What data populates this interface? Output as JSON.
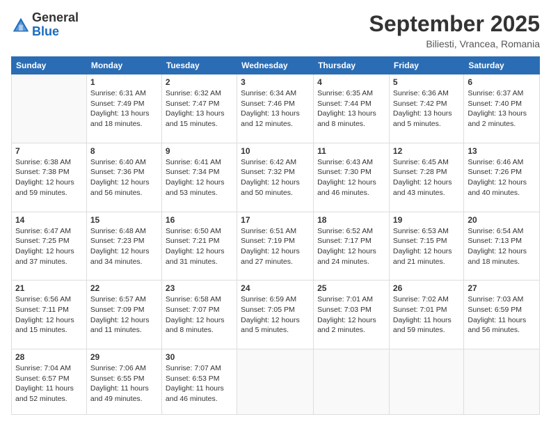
{
  "logo": {
    "general": "General",
    "blue": "Blue"
  },
  "header": {
    "month": "September 2025",
    "location": "Biliesti, Vrancea, Romania"
  },
  "days_of_week": [
    "Sunday",
    "Monday",
    "Tuesday",
    "Wednesday",
    "Thursday",
    "Friday",
    "Saturday"
  ],
  "weeks": [
    [
      {
        "num": "",
        "sunrise": "",
        "sunset": "",
        "daylight": "",
        "empty": true
      },
      {
        "num": "1",
        "sunrise": "Sunrise: 6:31 AM",
        "sunset": "Sunset: 7:49 PM",
        "daylight": "Daylight: 13 hours and 18 minutes."
      },
      {
        "num": "2",
        "sunrise": "Sunrise: 6:32 AM",
        "sunset": "Sunset: 7:47 PM",
        "daylight": "Daylight: 13 hours and 15 minutes."
      },
      {
        "num": "3",
        "sunrise": "Sunrise: 6:34 AM",
        "sunset": "Sunset: 7:46 PM",
        "daylight": "Daylight: 13 hours and 12 minutes."
      },
      {
        "num": "4",
        "sunrise": "Sunrise: 6:35 AM",
        "sunset": "Sunset: 7:44 PM",
        "daylight": "Daylight: 13 hours and 8 minutes."
      },
      {
        "num": "5",
        "sunrise": "Sunrise: 6:36 AM",
        "sunset": "Sunset: 7:42 PM",
        "daylight": "Daylight: 13 hours and 5 minutes."
      },
      {
        "num": "6",
        "sunrise": "Sunrise: 6:37 AM",
        "sunset": "Sunset: 7:40 PM",
        "daylight": "Daylight: 13 hours and 2 minutes."
      }
    ],
    [
      {
        "num": "7",
        "sunrise": "Sunrise: 6:38 AM",
        "sunset": "Sunset: 7:38 PM",
        "daylight": "Daylight: 12 hours and 59 minutes."
      },
      {
        "num": "8",
        "sunrise": "Sunrise: 6:40 AM",
        "sunset": "Sunset: 7:36 PM",
        "daylight": "Daylight: 12 hours and 56 minutes."
      },
      {
        "num": "9",
        "sunrise": "Sunrise: 6:41 AM",
        "sunset": "Sunset: 7:34 PM",
        "daylight": "Daylight: 12 hours and 53 minutes."
      },
      {
        "num": "10",
        "sunrise": "Sunrise: 6:42 AM",
        "sunset": "Sunset: 7:32 PM",
        "daylight": "Daylight: 12 hours and 50 minutes."
      },
      {
        "num": "11",
        "sunrise": "Sunrise: 6:43 AM",
        "sunset": "Sunset: 7:30 PM",
        "daylight": "Daylight: 12 hours and 46 minutes."
      },
      {
        "num": "12",
        "sunrise": "Sunrise: 6:45 AM",
        "sunset": "Sunset: 7:28 PM",
        "daylight": "Daylight: 12 hours and 43 minutes."
      },
      {
        "num": "13",
        "sunrise": "Sunrise: 6:46 AM",
        "sunset": "Sunset: 7:26 PM",
        "daylight": "Daylight: 12 hours and 40 minutes."
      }
    ],
    [
      {
        "num": "14",
        "sunrise": "Sunrise: 6:47 AM",
        "sunset": "Sunset: 7:25 PM",
        "daylight": "Daylight: 12 hours and 37 minutes."
      },
      {
        "num": "15",
        "sunrise": "Sunrise: 6:48 AM",
        "sunset": "Sunset: 7:23 PM",
        "daylight": "Daylight: 12 hours and 34 minutes."
      },
      {
        "num": "16",
        "sunrise": "Sunrise: 6:50 AM",
        "sunset": "Sunset: 7:21 PM",
        "daylight": "Daylight: 12 hours and 31 minutes."
      },
      {
        "num": "17",
        "sunrise": "Sunrise: 6:51 AM",
        "sunset": "Sunset: 7:19 PM",
        "daylight": "Daylight: 12 hours and 27 minutes."
      },
      {
        "num": "18",
        "sunrise": "Sunrise: 6:52 AM",
        "sunset": "Sunset: 7:17 PM",
        "daylight": "Daylight: 12 hours and 24 minutes."
      },
      {
        "num": "19",
        "sunrise": "Sunrise: 6:53 AM",
        "sunset": "Sunset: 7:15 PM",
        "daylight": "Daylight: 12 hours and 21 minutes."
      },
      {
        "num": "20",
        "sunrise": "Sunrise: 6:54 AM",
        "sunset": "Sunset: 7:13 PM",
        "daylight": "Daylight: 12 hours and 18 minutes."
      }
    ],
    [
      {
        "num": "21",
        "sunrise": "Sunrise: 6:56 AM",
        "sunset": "Sunset: 7:11 PM",
        "daylight": "Daylight: 12 hours and 15 minutes."
      },
      {
        "num": "22",
        "sunrise": "Sunrise: 6:57 AM",
        "sunset": "Sunset: 7:09 PM",
        "daylight": "Daylight: 12 hours and 11 minutes."
      },
      {
        "num": "23",
        "sunrise": "Sunrise: 6:58 AM",
        "sunset": "Sunset: 7:07 PM",
        "daylight": "Daylight: 12 hours and 8 minutes."
      },
      {
        "num": "24",
        "sunrise": "Sunrise: 6:59 AM",
        "sunset": "Sunset: 7:05 PM",
        "daylight": "Daylight: 12 hours and 5 minutes."
      },
      {
        "num": "25",
        "sunrise": "Sunrise: 7:01 AM",
        "sunset": "Sunset: 7:03 PM",
        "daylight": "Daylight: 12 hours and 2 minutes."
      },
      {
        "num": "26",
        "sunrise": "Sunrise: 7:02 AM",
        "sunset": "Sunset: 7:01 PM",
        "daylight": "Daylight: 11 hours and 59 minutes."
      },
      {
        "num": "27",
        "sunrise": "Sunrise: 7:03 AM",
        "sunset": "Sunset: 6:59 PM",
        "daylight": "Daylight: 11 hours and 56 minutes."
      }
    ],
    [
      {
        "num": "28",
        "sunrise": "Sunrise: 7:04 AM",
        "sunset": "Sunset: 6:57 PM",
        "daylight": "Daylight: 11 hours and 52 minutes."
      },
      {
        "num": "29",
        "sunrise": "Sunrise: 7:06 AM",
        "sunset": "Sunset: 6:55 PM",
        "daylight": "Daylight: 11 hours and 49 minutes."
      },
      {
        "num": "30",
        "sunrise": "Sunrise: 7:07 AM",
        "sunset": "Sunset: 6:53 PM",
        "daylight": "Daylight: 11 hours and 46 minutes."
      },
      {
        "num": "",
        "sunrise": "",
        "sunset": "",
        "daylight": "",
        "empty": true
      },
      {
        "num": "",
        "sunrise": "",
        "sunset": "",
        "daylight": "",
        "empty": true
      },
      {
        "num": "",
        "sunrise": "",
        "sunset": "",
        "daylight": "",
        "empty": true
      },
      {
        "num": "",
        "sunrise": "",
        "sunset": "",
        "daylight": "",
        "empty": true
      }
    ]
  ]
}
